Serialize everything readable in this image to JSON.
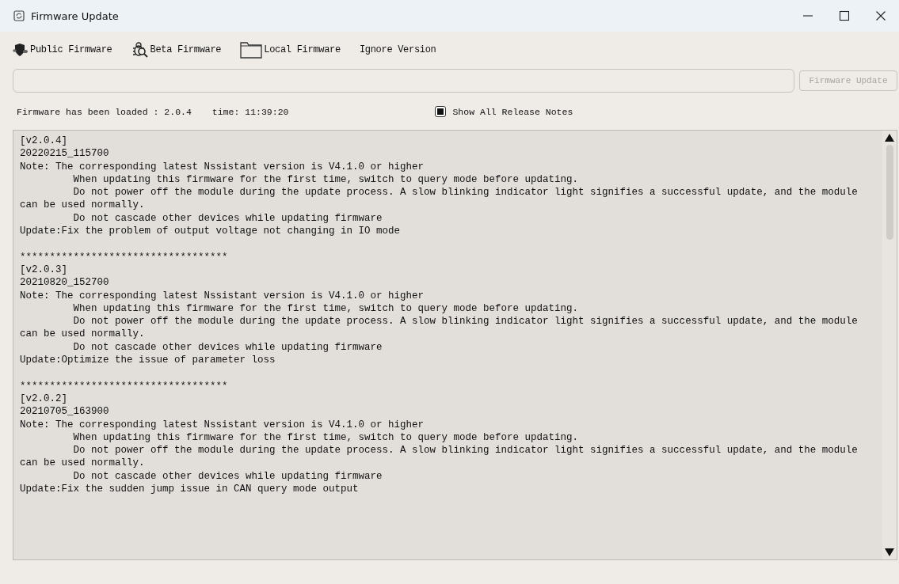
{
  "window": {
    "title": "Firmware Update"
  },
  "toolbar": [
    {
      "label": "Public Firmware",
      "kind": "shield"
    },
    {
      "label": "Beta Firmware",
      "kind": "bug"
    },
    {
      "label": "Local Firmware",
      "kind": "folder"
    },
    {
      "label": "Ignore Version",
      "kind": "plain"
    }
  ],
  "update_button": {
    "label": "Firmware Update",
    "disabled": true
  },
  "status": {
    "loaded": "Firmware has been loaded : 2.0.4",
    "time": "time: 11:39:20"
  },
  "show_all_notes": {
    "label": "Show All Release Notes",
    "checked": true
  },
  "release_notes": [
    {
      "version": "[v2.0.4]",
      "date": "20220215_115700",
      "lines": [
        {
          "text": "Note: The corresponding latest Nssistant version is V4.1.0 or higher",
          "indent": false
        },
        {
          "text": "When updating this firmware for the first time, switch to query mode before updating.",
          "indent": true
        },
        {
          "text": "Do not power off the module during the update process. A slow blinking indicator light signifies a successful update, and the module can be used normally.",
          "indent": true
        },
        {
          "text": "Do not cascade other devices while updating firmware",
          "indent": true
        },
        {
          "text": "Update:Fix the problem of output voltage not changing in IO mode",
          "indent": false
        }
      ]
    },
    {
      "separator": "***********************************",
      "version": "[v2.0.3]",
      "date": "20210820_152700",
      "lines": [
        {
          "text": "Note: The corresponding latest Nssistant version is V4.1.0 or higher",
          "indent": false
        },
        {
          "text": "When updating this firmware for the first time, switch to query mode before updating.",
          "indent": true
        },
        {
          "text": "Do not power off the module during the update process. A slow blinking indicator light signifies a successful update, and the module can be used normally.",
          "indent": true
        },
        {
          "text": "Do not cascade other devices while updating firmware",
          "indent": true
        },
        {
          "text": "Update:Optimize the issue of parameter loss",
          "indent": false
        }
      ]
    },
    {
      "separator": "***********************************",
      "version": "[v2.0.2]",
      "date": "20210705_163900",
      "lines": [
        {
          "text": "Note: The corresponding latest Nssistant version is V4.1.0 or higher",
          "indent": false
        },
        {
          "text": "When updating this firmware for the first time, switch to query mode before updating.",
          "indent": true
        },
        {
          "text": "Do not power off the module during the update process. A slow blinking indicator light signifies a successful update, and the module can be used normally.",
          "indent": true
        },
        {
          "text": "Do not cascade other devices while updating firmware",
          "indent": true
        },
        {
          "text": "Update:Fix the sudden jump issue in CAN query mode output",
          "indent": false
        }
      ]
    }
  ]
}
